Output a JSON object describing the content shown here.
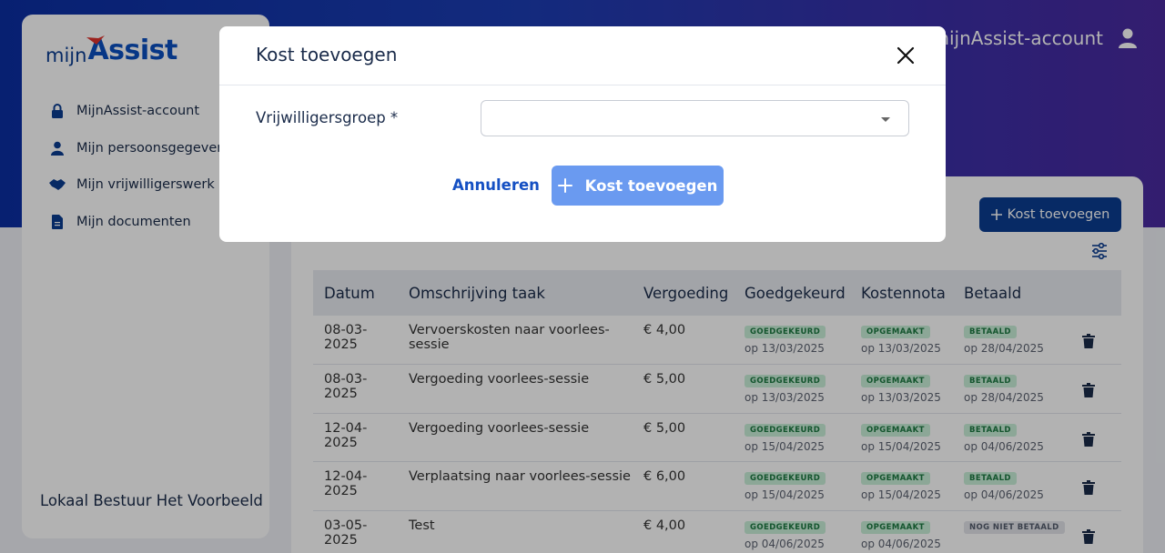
{
  "header": {
    "account_label": "mijnAssist-account"
  },
  "logo": {
    "part1": "mijn",
    "part2": "Assist"
  },
  "sidebar": {
    "items": [
      {
        "label": "MijnAssist-account",
        "icon": "lock-icon"
      },
      {
        "label": "Mijn persoonsgegevens",
        "icon": "person-icon"
      },
      {
        "label": "Mijn vrijwilligerswerk",
        "icon": "handshake-icon"
      },
      {
        "label": "Mijn documenten",
        "icon": "document-icon"
      }
    ],
    "organization": "Lokaal Bestuur Het Voorbeeld"
  },
  "main": {
    "add_button_label": "Kost toevoegen",
    "table": {
      "columns": [
        "Datum",
        "Omschrijving taak",
        "Vergoeding",
        "Goedgekeurd",
        "Kostennota",
        "Betaald"
      ],
      "rows": [
        {
          "date": "08-03-2025",
          "desc": "Vervoerskosten naar voorlees-sessie",
          "amount": "€ 4,00",
          "approved": "GOEDGEKEURD",
          "approved_on": "op 13/03/2025",
          "note": "OPGEMAAKT",
          "note_on": "op 13/03/2025",
          "paid": "BETAALD",
          "paid_on": "op 28/04/2025"
        },
        {
          "date": "08-03-2025",
          "desc": "Vergoeding voorlees-sessie",
          "amount": "€ 5,00",
          "approved": "GOEDGEKEURD",
          "approved_on": "op 13/03/2025",
          "note": "OPGEMAAKT",
          "note_on": "op 13/03/2025",
          "paid": "BETAALD",
          "paid_on": "op 28/04/2025"
        },
        {
          "date": "12-04-2025",
          "desc": "Vergoeding voorlees-sessie",
          "amount": "€ 5,00",
          "approved": "GOEDGEKEURD",
          "approved_on": "op 15/04/2025",
          "note": "OPGEMAAKT",
          "note_on": "op 15/04/2025",
          "paid": "BETAALD",
          "paid_on": "op 04/06/2025"
        },
        {
          "date": "12-04-2025",
          "desc": "Verplaatsing naar voorlees-sessie",
          "amount": "€ 6,00",
          "approved": "GOEDGEKEURD",
          "approved_on": "op 15/04/2025",
          "note": "OPGEMAAKT",
          "note_on": "op 15/04/2025",
          "paid": "BETAALD",
          "paid_on": "op 04/06/2025"
        },
        {
          "date": "03-05-2025",
          "desc": "Test",
          "amount": "€ 4,00",
          "approved": "GOEDGEKEURD",
          "approved_on": "op 04/06/2025",
          "note": "OPGEMAAKT",
          "note_on": "op 04/06/2025",
          "paid": "NOG NIET BETAALD",
          "paid_on": ""
        }
      ]
    }
  },
  "modal": {
    "title": "Kost toevoegen",
    "field_label": "Vrijwilligersgroep *",
    "select_value": "",
    "cancel_label": "Annuleren",
    "submit_label": "Kost toevoegen"
  },
  "colors": {
    "primary": "#0b3d91",
    "accent": "#1550c3",
    "submit_disabled": "#6a9af0",
    "badge_green_bg": "#c9efd8",
    "badge_green_text": "#1d7a43",
    "badge_grey_bg": "#e2e4ea"
  }
}
